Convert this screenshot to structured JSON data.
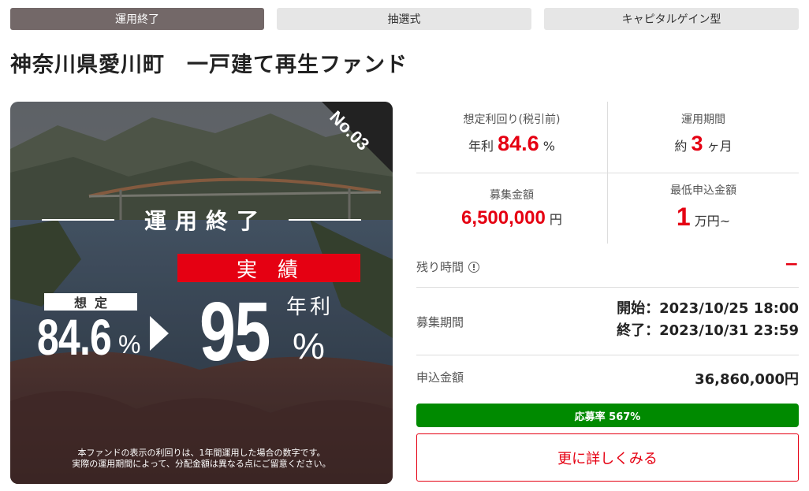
{
  "tags": {
    "status": "運用終了",
    "method": "抽選式",
    "type": "キャピタルゲイン型"
  },
  "fund_title": "神奈川県愛川町　一戸建て再生ファンド",
  "hero": {
    "number": "No.03",
    "end_label": "運用終了",
    "actual_label": "実績",
    "assumed_label": "想定",
    "assumed_value": "84.6",
    "assumed_unit": "%",
    "actual_value": "95",
    "annual_label": "年利",
    "actual_unit": "%",
    "note_line1": "本ファンドの表示の利回りは、1年間運用した場合の数字です。",
    "note_line2": "実際の運用期間によって、分配金額は異なる点にご留意ください。"
  },
  "stats": {
    "yield": {
      "label": "想定利回り(税引前)",
      "prefix": "年利",
      "value": "84.6",
      "unit": "%"
    },
    "period": {
      "label": "運用期間",
      "prefix": "約",
      "value": "3",
      "unit": "ヶ月"
    },
    "raise": {
      "label": "募集金額",
      "value": "6,500,000",
      "unit": "円"
    },
    "minimum": {
      "label": "最低申込金額",
      "value": "1",
      "unit": "万円~"
    }
  },
  "remaining": {
    "label": "残り時間",
    "value": "−"
  },
  "recruit_period": {
    "label": "募集期間",
    "start": "開始：2023/10/25 18:00",
    "end": "終了：2023/10/31 23:59"
  },
  "applied": {
    "label": "申込金額",
    "value": "36,860,000円"
  },
  "progress": {
    "text": "応募率 567%",
    "fill_fraction": 1.0,
    "color": "#008a00"
  },
  "detail_button": "更に詳しくみる",
  "colors": {
    "accent_red": "#e50012",
    "status_tag": "#736868",
    "tag_gray": "#e6e6e6"
  }
}
